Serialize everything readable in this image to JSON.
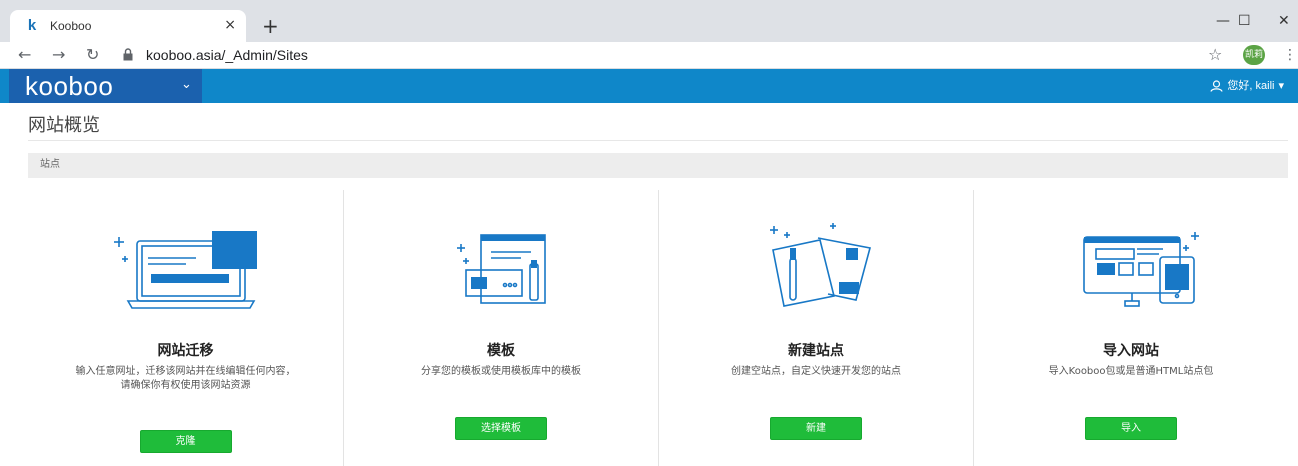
{
  "browser": {
    "tab_title": "Kooboo",
    "tab_close": "×",
    "new_tab": "+",
    "url": "kooboo.asia/_Admin/Sites",
    "profile_label": "凯莉",
    "window_controls": {
      "minimize": "—",
      "maximize": "☐",
      "close": "✕"
    },
    "nav": {
      "back": "←",
      "forward": "→",
      "reload": "↻"
    },
    "star": "☆",
    "menu": "⋮"
  },
  "header": {
    "logo": "kooboo",
    "logo_caret": "⌄",
    "user_greeting": "您好, kaili",
    "user_caret": "▾",
    "colors": {
      "bar": "#0f87c9",
      "logo_box": "#1b61ae"
    }
  },
  "page": {
    "title": "网站概览",
    "breadcrumb": "站点"
  },
  "cards": [
    {
      "title": "网站迁移",
      "description": "输入任意网址，迁移该网站并在线编辑任何内容，请确保你有权使用该网站资源",
      "button": "克隆",
      "illustration": "laptop-icon"
    },
    {
      "title": "模板",
      "description": "分享您的模板或使用模板库中的模板",
      "button": "选择模板",
      "illustration": "template-icon"
    },
    {
      "title": "新建站点",
      "description": "创建空站点，自定义快速开发您的站点",
      "button": "新建",
      "illustration": "design-tools-icon"
    },
    {
      "title": "导入网站",
      "description": "导入Kooboo包或是普通HTML站点包",
      "button": "导入",
      "illustration": "devices-icon"
    }
  ],
  "accent_colors": {
    "primary_button": "#1fbc3a",
    "illustration_blue": "#1878c6"
  }
}
